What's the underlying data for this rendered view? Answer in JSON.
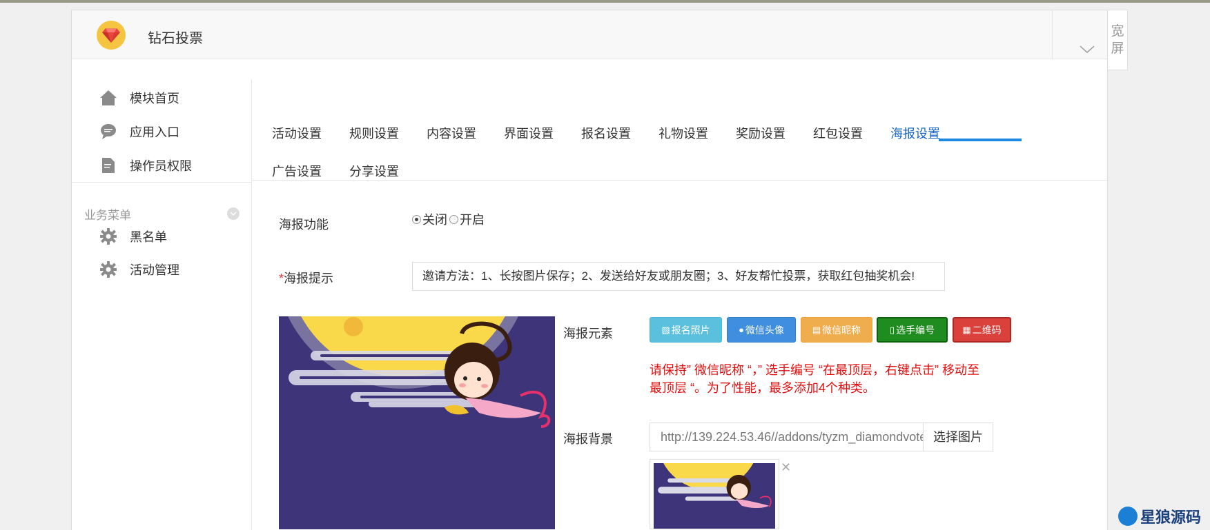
{
  "app": {
    "title": "钻石投票",
    "wide_screen_label": "宽屏"
  },
  "sidebar": {
    "items": [
      {
        "label": "模块首页",
        "icon": "home-icon"
      },
      {
        "label": "应用入口",
        "icon": "chat-icon"
      },
      {
        "label": "操作员权限",
        "icon": "document-icon"
      }
    ],
    "section_label": "业务菜单",
    "business_items": [
      {
        "label": "黑名单",
        "icon": "gear-icon"
      },
      {
        "label": "活动管理",
        "icon": "gear-icon"
      }
    ]
  },
  "tabs": {
    "items": [
      "活动设置",
      "规则设置",
      "内容设置",
      "界面设置",
      "报名设置",
      "礼物设置",
      "奖励设置",
      "红包设置",
      "海报设置",
      "广告设置",
      "分享设置"
    ],
    "active": "海报设置"
  },
  "form": {
    "poster_function_label": "海报功能",
    "radio_off": "关闭",
    "radio_on": "开启",
    "selected": "关闭",
    "tip_required_mark": "*",
    "tip_label": "海报提示",
    "tip_value": "邀请方法：1、长按图片保存；2、发送给好友或朋友圈；3、好友帮忙投票，获取红包抽奖机会!",
    "elements_label": "海报元素",
    "element_buttons": [
      {
        "label": "报名照片",
        "icon": "image-icon",
        "color": "#5bc0de"
      },
      {
        "label": "微信头像",
        "icon": "user-icon",
        "color": "#3f8ee0"
      },
      {
        "label": "微信昵称",
        "icon": "text-icon",
        "color": "#f0ad4e"
      },
      {
        "label": "选手编号",
        "icon": "file-icon",
        "color": "#1e8c1e"
      },
      {
        "label": "二维码",
        "icon": "qrcode-icon",
        "color": "#d9413a"
      }
    ],
    "warning_line1": "请保持” 微信昵称 “，” 选手编号 “在最顶层，右键点击” 移动至",
    "warning_line2": "最顶层 “。为了性能，最多添加4个种类。",
    "background_label": "海报背景",
    "background_url": "http://139.224.53.46//addons/tyzm_diamondvote",
    "choose_image_label": "选择图片",
    "remove_icon": "close-icon"
  },
  "watermark": "星狼源码"
}
